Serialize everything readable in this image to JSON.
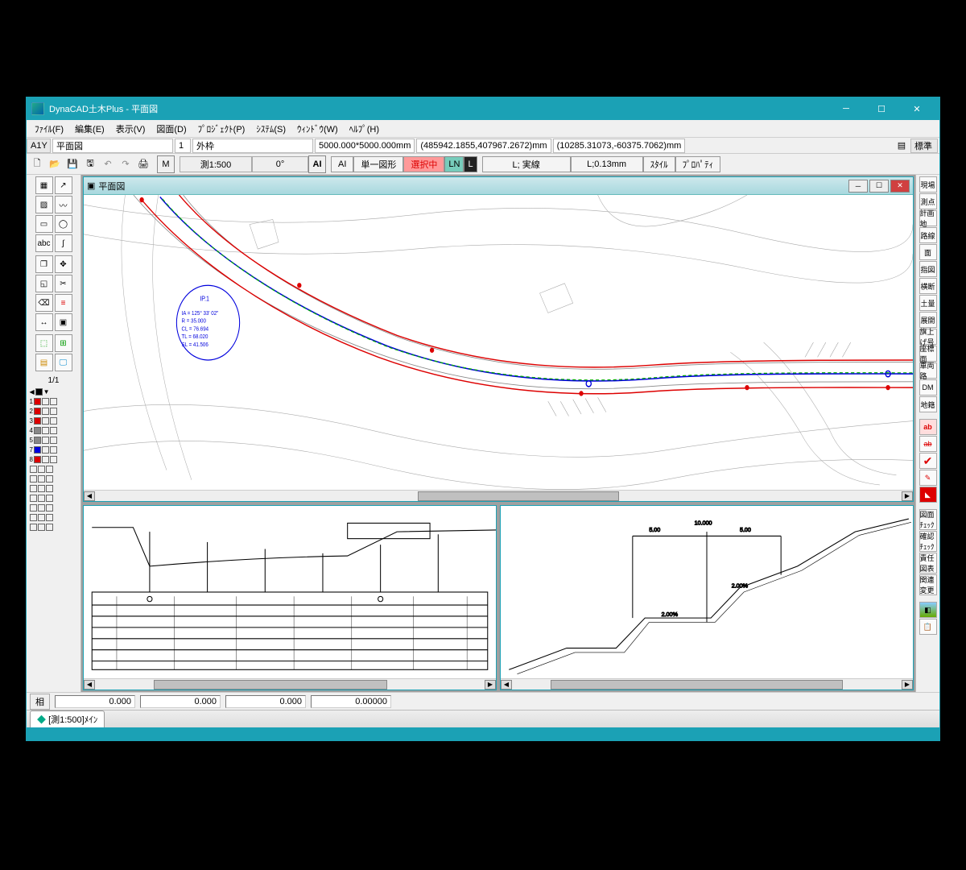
{
  "title": "DynaCAD土木Plus - 平面図",
  "menu": {
    "file": "ﾌｧｲﾙ(F)",
    "edit": "編集(E)",
    "view": "表示(V)",
    "drawing": "図面(D)",
    "project": "ﾌﾟﾛｼﾞｪｸﾄ(P)",
    "system": "ｼｽﾃﾑ(S)",
    "window": "ｳｨﾝﾄﾞｳ(W)",
    "help": "ﾍﾙﾌﾟ(H)"
  },
  "info": {
    "sheet": "A1Y",
    "name": "平面図",
    "page": "1",
    "frame": "外枠",
    "size": "5000.000*5000.000mm",
    "coord1": "(485942.1855,407967.2672)mm",
    "coord2": "(10285.31073,-60375.7062)mm",
    "std": "標準"
  },
  "tb": {
    "scale": "測1:500",
    "angle": "0°",
    "ai": "AI",
    "ai2": "AI",
    "single": "単一図形",
    "selecting": "選択中",
    "ln": "LN",
    "l": "L",
    "linetype": "L; 実線",
    "lw": "L;0.13mm",
    "style": "ｽﾀｲﾙ",
    "prop": "ﾌﾟﾛﾊﾟﾃｨ"
  },
  "subwin_title": "平面図",
  "layers": {
    "page": "1/1"
  },
  "curve": {
    "ip": "IP.1",
    "ia": "IA = 125° 33' 02\"",
    "r": "R  =  35.000",
    "cl": "CL =  76.694",
    "tl": "TL =  68.020",
    "sl": "SL =  41.506"
  },
  "status": {
    "label": "相",
    "v1": "0.000",
    "v2": "0.000",
    "v3": "0.000",
    "v4": "0.00000"
  },
  "tab": "[測1:500]ﾒｲﾝ",
  "right": {
    "r1": "現場",
    "r2": "測点",
    "r3": "計画地",
    "r4": "路線",
    "r5": "面",
    "r6": "指図",
    "r7": "横断",
    "r8": "土量",
    "r9": "展開",
    "r10": "旗上げ号",
    "r11": "座標面",
    "r12": "車両路",
    "r13": "DM",
    "r14": "地籍",
    "ab": "ab",
    "chk1": "図面ﾁｪｯｸ",
    "chk2": "確認ﾁｪｯｸ",
    "chk3": "責任図表",
    "chk4": "関連変更"
  }
}
